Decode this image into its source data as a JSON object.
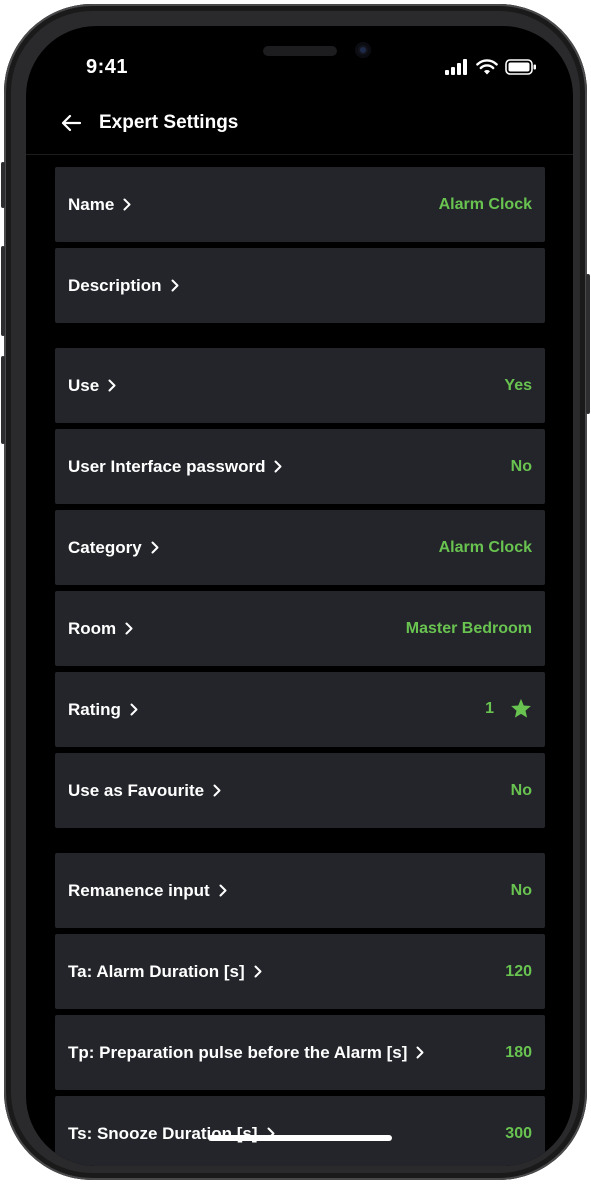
{
  "status_bar": {
    "time": "9:41"
  },
  "header": {
    "title": "Expert Settings"
  },
  "colors": {
    "accent": "#69c350",
    "row_bg": "#23252a",
    "screen_bg": "#000000"
  },
  "rows": [
    {
      "label": "Name",
      "value": "Alarm Clock"
    },
    {
      "label": "Description",
      "value": ""
    },
    {
      "label": "Use",
      "value": "Yes"
    },
    {
      "label": "User Interface password",
      "value": "No"
    },
    {
      "label": "Category",
      "value": "Alarm Clock"
    },
    {
      "label": "Room",
      "value": "Master Bedroom"
    },
    {
      "label": "Rating",
      "value": "1",
      "icon": "star-icon"
    },
    {
      "label": "Use as Favourite",
      "value": "No"
    },
    {
      "label": "Remanence input",
      "value": "No"
    },
    {
      "label": "Ta: Alarm Duration [s]",
      "value": "120"
    },
    {
      "label": "Tp: Preparation pulse before the Alarm [s]",
      "value": "180"
    },
    {
      "label": "Ts: Snooze Duration [s]",
      "value": "300"
    }
  ]
}
